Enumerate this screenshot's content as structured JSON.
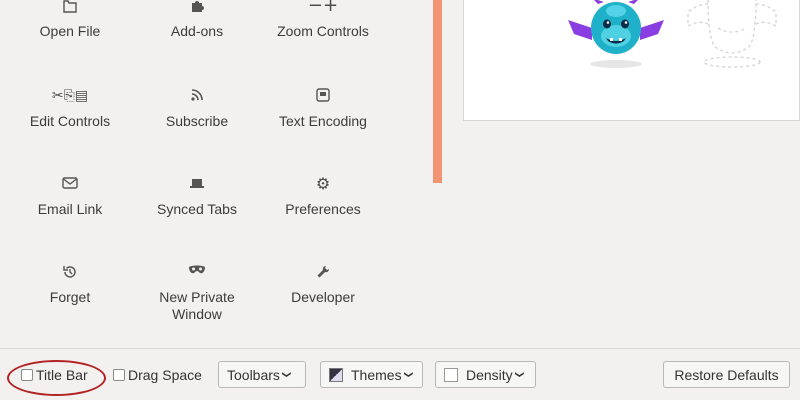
{
  "palette": {
    "items": [
      {
        "label": "Open File",
        "icon": "folder-icon"
      },
      {
        "label": "Add-ons",
        "icon": "puzzle-icon"
      },
      {
        "label": "Zoom Controls",
        "icon": "zoom-icon",
        "glyph": "−+"
      },
      {
        "label": "Edit Controls",
        "icon": "cut-copy-paste-icon",
        "glyph": "✂⎘▤"
      },
      {
        "label": "Subscribe",
        "icon": "rss-icon"
      },
      {
        "label": "Text Encoding",
        "icon": "text-encoding-icon"
      },
      {
        "label": "Email Link",
        "icon": "mail-icon"
      },
      {
        "label": "Synced Tabs",
        "icon": "synced-tabs-icon"
      },
      {
        "label": "Preferences",
        "icon": "gear-icon",
        "glyph": "⚙"
      },
      {
        "label": "Forget",
        "icon": "forget-icon"
      },
      {
        "label": "New Private Window",
        "icon": "private-mask-icon"
      },
      {
        "label": "Developer",
        "icon": "wrench-icon"
      }
    ]
  },
  "footer": {
    "title_bar_label": "Title Bar",
    "drag_space_label": "Drag Space",
    "toolbars_label": "Toolbars",
    "themes_label": "Themes",
    "density_label": "Density",
    "restore_label": "Restore Defaults"
  },
  "colors": {
    "accent": "#f29372",
    "monster": "#1fb1c9",
    "wings": "#8a3de0",
    "highlight": "#b32222"
  }
}
